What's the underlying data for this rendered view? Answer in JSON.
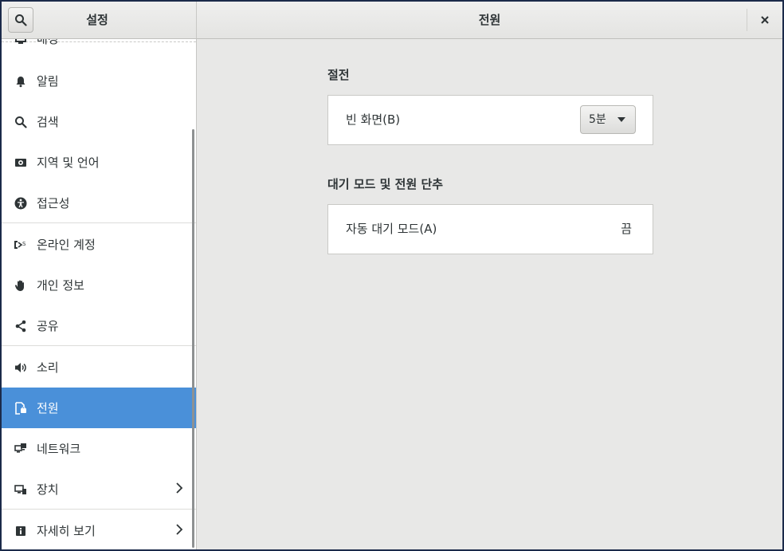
{
  "header": {
    "left_title": "설정",
    "title": "전원"
  },
  "sidebar": {
    "items": [
      {
        "label": "배경",
        "icon": "background-icon"
      },
      {
        "label": "알림",
        "icon": "bell-icon"
      },
      {
        "label": "검색",
        "icon": "search-icon"
      },
      {
        "label": "지역 및 언어",
        "icon": "region-icon"
      },
      {
        "label": "접근성",
        "icon": "accessibility-icon"
      },
      {
        "label": "온라인 계정",
        "icon": "online-accounts-icon"
      },
      {
        "label": "개인 정보",
        "icon": "hand-icon"
      },
      {
        "label": "공유",
        "icon": "share-icon"
      },
      {
        "label": "소리",
        "icon": "speaker-icon"
      },
      {
        "label": "전원",
        "icon": "power-icon",
        "active": true
      },
      {
        "label": "네트워크",
        "icon": "network-icon"
      },
      {
        "label": "장치",
        "icon": "devices-icon"
      },
      {
        "label": "자세히 보기",
        "icon": "info-icon"
      }
    ]
  },
  "main": {
    "power_saving": {
      "title": "절전",
      "blank_screen_label": "빈 화면(B)",
      "blank_screen_value": "5분"
    },
    "suspend": {
      "title": "대기 모드 및 전원 단추",
      "auto_suspend_label": "자동 대기 모드(A)",
      "auto_suspend_value": "끔"
    }
  },
  "colors": {
    "accent": "#4a90d9",
    "content_bg": "#e8e8e7"
  }
}
